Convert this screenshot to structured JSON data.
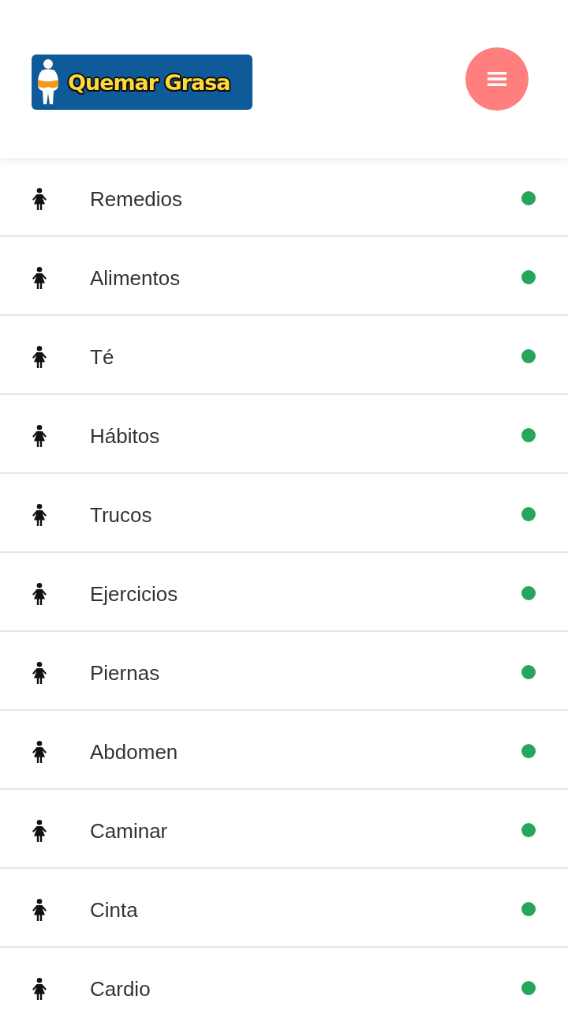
{
  "header": {
    "logo_text": "Quemar Grasa"
  },
  "menu": [
    {
      "label": "Remedios"
    },
    {
      "label": "Alimentos"
    },
    {
      "label": "Té"
    },
    {
      "label": "Hábitos"
    },
    {
      "label": "Trucos"
    },
    {
      "label": "Ejercicios"
    },
    {
      "label": "Piernas"
    },
    {
      "label": "Abdomen"
    },
    {
      "label": "Caminar"
    },
    {
      "label": "Cinta"
    },
    {
      "label": "Cardio"
    }
  ]
}
